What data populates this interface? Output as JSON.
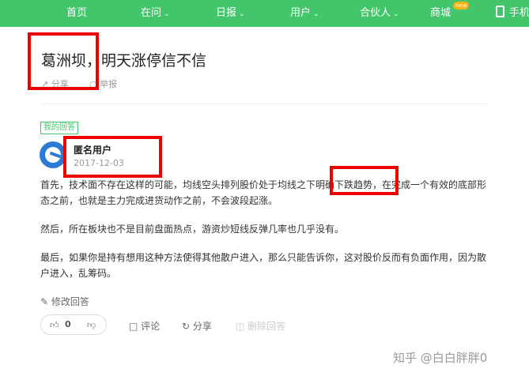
{
  "nav": {
    "home": "首页",
    "ask": "在问",
    "daily": "日报",
    "user": "用户",
    "partner": "合伙人",
    "mall": "商城",
    "mall_badge": "new",
    "mobile": "手机"
  },
  "question": {
    "title": "葛洲坝，明天涨停信不信",
    "share": "分享",
    "report": "举报"
  },
  "answer": {
    "tag": "我的回答",
    "username": "匿名用户",
    "date": "2017-12-03",
    "paragraphs": [
      "首先，技术面不存在这样的可能，均线空头排列股价处于均线之下明确下跌趋势，在完成一个有效的底部形态之前，也就是主力完成进货动作之前，不会波段起涨。",
      "然后，所在板块也不是目前盘面热点，游资炒短线反弹几率也几乎没有。",
      "最后，如果你是持有想用这种方法使得其他散户进入，那么只能告诉你，这对股价反而有负面作用，因为散户进入，乱筹码。"
    ],
    "edit": "修改回答",
    "vote_count": "0",
    "comment": "评论",
    "share": "分享",
    "delete": "删除回答"
  },
  "watermark": "知乎 @白白胖胖0",
  "colors": {
    "brand": "#43c66b",
    "highlight": "#e00000",
    "badge": "#f5b11a"
  }
}
